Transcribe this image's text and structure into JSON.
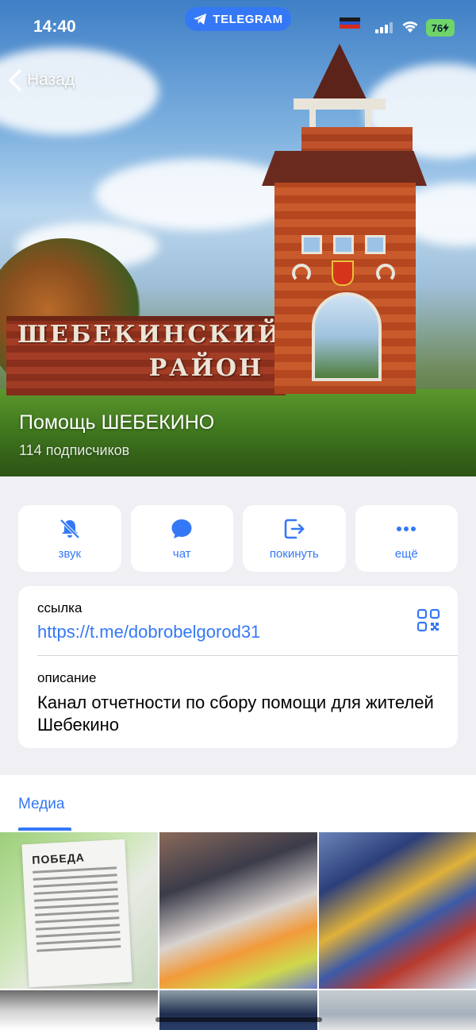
{
  "status_bar": {
    "time": "14:40",
    "app_badge": "TELEGRAM",
    "battery": "76"
  },
  "nav": {
    "back_label": "Назад"
  },
  "cover": {
    "sign_line1": "ШЕБЕКИНСКИЙ",
    "sign_line2": "РАЙОН"
  },
  "channel": {
    "title": "Помощь ШЕБЕКИНО",
    "subscribers": "114 подписчиков"
  },
  "actions": [
    {
      "label": "звук",
      "icon": "bell-muted-icon"
    },
    {
      "label": "чат",
      "icon": "chat-bubble-icon"
    },
    {
      "label": "покинуть",
      "icon": "leave-icon"
    },
    {
      "label": "ещё",
      "icon": "more-icon"
    }
  ],
  "info": {
    "link_label": "ссылка",
    "link_value": "https://t.me/dobrobelgorod31",
    "description_label": "описание",
    "description_value": "Канал отчетности по сбору помощи для жителей Шебекино"
  },
  "media": {
    "tab_label": "Медиа",
    "receipt_brand": "ПОБЕДА"
  },
  "colors": {
    "accent": "#3478f6",
    "background": "#efeff4"
  }
}
